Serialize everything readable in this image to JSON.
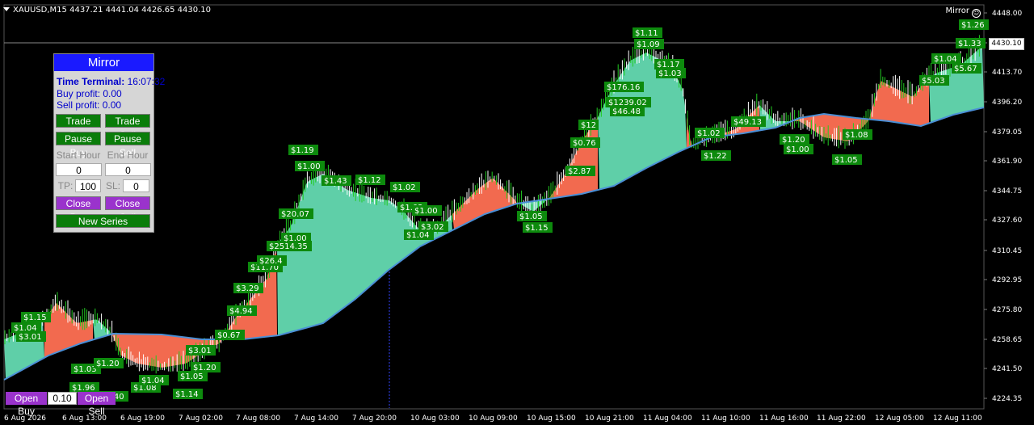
{
  "header": {
    "symbol_text": "XAUUSD,M15  4437.21 4441.04 4426.65 4430.10"
  },
  "ea_name": "Mirror",
  "current_price": "4430.10",
  "price_axis": [
    "4448.00",
    "4430.10",
    "4413.70",
    "4396.20",
    "4379.05",
    "4361.90",
    "4344.75",
    "4327.60",
    "4310.45",
    "4292.95",
    "4275.80",
    "4258.65",
    "4241.50",
    "4224.35"
  ],
  "time_axis": [
    "6 Aug 2026",
    "6 Aug 13:00",
    "6 Aug 19:00",
    "7 Aug 02:00",
    "7 Aug 08:00",
    "7 Aug 14:00",
    "7 Aug 20:00",
    "10 Aug 03:00",
    "10 Aug 09:00",
    "10 Aug 15:00",
    "10 Aug 21:00",
    "11 Aug 04:00",
    "11 Aug 10:00",
    "11 Aug 16:00",
    "11 Aug 22:00",
    "12 Aug 05:00",
    "12 Aug 11:00"
  ],
  "panel": {
    "title": "Mirror",
    "time_label": "Time Terminal:",
    "time_value": "16:07:32",
    "buy_profit": "Buy profit: 0.00",
    "sell_profit": "Sell profit: 0.00",
    "trade_buy": "Trade Buy",
    "trade_sell": "Trade Sell",
    "pause_buy": "Pause Buy",
    "pause_sell": "Pause Sell",
    "start_hour_label": "Start Hour",
    "end_hour_label": "End Hour",
    "start_hour": "0",
    "end_hour": "0",
    "tp_label": "TP:",
    "tp_value": "100",
    "sl_label": "SL:",
    "sl_value": "0",
    "close_buy": "Close Buy",
    "close_sell": "Close Sell",
    "new_series": "New Series"
  },
  "bottom": {
    "open_buy": "Open Buy",
    "lot": "0.10",
    "open_sell": "Open Sell"
  },
  "profit_labels": [
    {
      "t": "$1.15"
    },
    {
      "t": "$1.04"
    },
    {
      "t": "$3.01"
    },
    {
      "t": "$1.03"
    },
    {
      "t": "$1.20"
    },
    {
      "t": "$1.96"
    },
    {
      "t": "$1.40"
    },
    {
      "t": "$1.08"
    },
    {
      "t": "$1.04"
    },
    {
      "t": "$1.05"
    },
    {
      "t": "$1.14"
    },
    {
      "t": "$3.01"
    },
    {
      "t": "$1.20"
    },
    {
      "t": "$0.67"
    },
    {
      "t": "$4.94"
    },
    {
      "t": "$3.29"
    },
    {
      "t": "$11.70"
    },
    {
      "t": "$26.4"
    },
    {
      "t": "$2514.35"
    },
    {
      "t": "$1.00"
    },
    {
      "t": "$20.07"
    },
    {
      "t": "$1.19"
    },
    {
      "t": "$1.00"
    },
    {
      "t": "$1.43"
    },
    {
      "t": "$1.12"
    },
    {
      "t": "$1.02"
    },
    {
      "t": "$1.02"
    },
    {
      "t": "$1.00"
    },
    {
      "t": "$3.02"
    },
    {
      "t": "$1.04"
    },
    {
      "t": "$1.05"
    },
    {
      "t": "$1.15"
    },
    {
      "t": "$2.87"
    },
    {
      "t": "$0.76"
    },
    {
      "t": "$12"
    },
    {
      "t": "$1239.02"
    },
    {
      "t": "$176.16"
    },
    {
      "t": "$46.48"
    },
    {
      "t": "$1.11"
    },
    {
      "t": "$1.09"
    },
    {
      "t": "$1.17"
    },
    {
      "t": "$1.03"
    },
    {
      "t": "$1.02"
    },
    {
      "t": "$1.22"
    },
    {
      "t": "$49.13"
    },
    {
      "t": "$1.20"
    },
    {
      "t": "$1.00"
    },
    {
      "t": "$1.05"
    },
    {
      "t": "$1.08"
    },
    {
      "t": "$1.04"
    },
    {
      "t": "$5.03"
    },
    {
      "t": "$5.67"
    },
    {
      "t": "$1.33"
    },
    {
      "t": "$1.26"
    }
  ],
  "colors": {
    "bull_area": "#5fcfa8",
    "bear_area": "#f26a4f",
    "ma_line": "#4a8fd6",
    "label_bg": "#0d8a0d"
  }
}
